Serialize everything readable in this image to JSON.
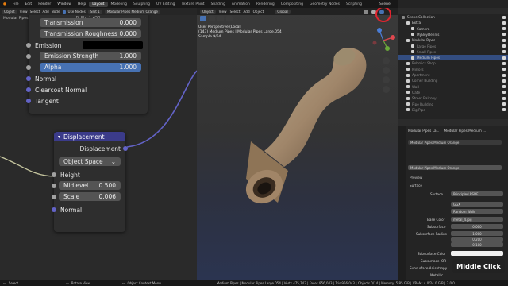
{
  "topbar": {
    "menus": [
      "File",
      "Edit",
      "Render",
      "Window",
      "Help"
    ],
    "tabs": [
      "Layout",
      "Modeling",
      "Sculpting",
      "UV Editing",
      "Texture Paint",
      "Shading",
      "Animation",
      "Rendering",
      "Compositing",
      "Geometry Nodes",
      "Scripting"
    ],
    "active_tab": "Layout",
    "scene": "Scene",
    "view_layer": "ViewLayer"
  },
  "node_header": {
    "mode": "Object",
    "menus": [
      "View",
      "Select",
      "Add",
      "Node"
    ],
    "use_nodes": "Use Nodes",
    "slot": "Slot 1",
    "material": "Modular Pipes Medium Orange",
    "breadcrumb": [
      "Modular Pipes Large.054",
      "Modular Pipes Medium Orange"
    ]
  },
  "bsdf_node": {
    "top_partial": "BLPh",
    "value_partial": "1.450",
    "transmission": {
      "label": "Transmission",
      "value": "0.000"
    },
    "transmission_roughness": {
      "label": "Transmission Roughness",
      "value": "0.000"
    },
    "emission": "Emission",
    "emission_strength": {
      "label": "Emission Strength",
      "value": "1.000"
    },
    "alpha": {
      "label": "Alpha",
      "value": "1.000"
    },
    "normal": "Normal",
    "clearcoat_normal": "Clearcoat Normal",
    "tangent": "Tangent"
  },
  "displacement_node": {
    "title": "Displacement",
    "output": "Displacement",
    "space": "Object Space",
    "height": "Height",
    "midlevel": {
      "label": "Midlevel",
      "value": "0.500"
    },
    "scale": {
      "label": "Scale",
      "value": "0.006"
    },
    "normal": "Normal"
  },
  "viewport": {
    "mode": "Object",
    "menus": [
      "View",
      "Select",
      "Add",
      "Object"
    ],
    "transform": "Global",
    "info_line1": "User Perspective (Local)",
    "info_line2": "(143) Medium Pipes | Modular Pipes Large.054",
    "info_line3": "Sample 9/64"
  },
  "outliner": {
    "title": "Scene Collection",
    "rows": [
      {
        "label": "Scene Collection",
        "dim": false,
        "sel": false,
        "indent": 0
      },
      {
        "label": "Extra",
        "dim": false,
        "sel": false,
        "indent": 1
      },
      {
        "label": "Camera",
        "dim": false,
        "sel": false,
        "indent": 2
      },
      {
        "label": "MyBoyDennis",
        "dim": false,
        "sel": false,
        "indent": 2
      },
      {
        "label": "Modular Pipes",
        "dim": false,
        "sel": false,
        "indent": 1
      },
      {
        "label": "Large Pipes",
        "dim": true,
        "sel": false,
        "indent": 2
      },
      {
        "label": "Small Pipes",
        "dim": true,
        "sel": false,
        "indent": 2
      },
      {
        "label": "Medium Pipes",
        "dim": false,
        "sel": true,
        "indent": 2
      },
      {
        "label": "Robotics Shop",
        "dim": true,
        "sel": false,
        "indent": 1
      },
      {
        "label": "Mirrors",
        "dim": true,
        "sel": false,
        "indent": 1
      },
      {
        "label": "Apartment",
        "dim": true,
        "sel": false,
        "indent": 1
      },
      {
        "label": "Corner Building",
        "dim": true,
        "sel": false,
        "indent": 1
      },
      {
        "label": "Wall",
        "dim": true,
        "sel": false,
        "indent": 1
      },
      {
        "label": "Gate",
        "dim": true,
        "sel": false,
        "indent": 1
      },
      {
        "label": "Street Balcony",
        "dim": true,
        "sel": false,
        "indent": 1
      },
      {
        "label": "Pipe Building",
        "dim": true,
        "sel": false,
        "indent": 1
      },
      {
        "label": "Big Pipe",
        "dim": true,
        "sel": false,
        "indent": 1
      }
    ]
  },
  "properties": {
    "object_name": "Modular Pipes La...",
    "material_name": "Modular Pipes Medium ...",
    "material_slot": "Modular Pipes Medium Orange",
    "datablock": "Modular Pipes Medium Orange",
    "preview": "Preview",
    "surface": "Surface",
    "surface_shader": "Principled BSDF",
    "distribution": "GGX",
    "subsurface_method": "Random Walk",
    "base_color_label": "Base Color",
    "base_color_value": "metal_4.jpg",
    "subsurface_label": "Subsurface",
    "subsurface_value": "0.000",
    "subsurface_radius_label": "Subsurface Radius",
    "radius_values": [
      "1.000",
      "0.200",
      "0.100"
    ],
    "subsurface_color_label": "Subsurface Color",
    "subsurface_ior_label": "Subsurface IOR",
    "subsurface_aniso_label": "Subsurface Anisotropy",
    "metallic_label": "Metallic"
  },
  "status": {
    "select": "Select",
    "rotate": "Rotate View",
    "context": "Object Context Menu",
    "stats": "Medium Pipes | Modular Pipes Large.054 | Verts 475,743 | Faces 956,043 | Tris 956,043 | Objects 0/14 | Memory: 5.85 GiB | VRAM: 4.0/24.0 GiB | 3.0.0"
  },
  "badge": "Middle Click",
  "colors": {
    "accent": "#4772b3",
    "socket": "#6363c7",
    "highlight_circle": "#e0242f"
  }
}
